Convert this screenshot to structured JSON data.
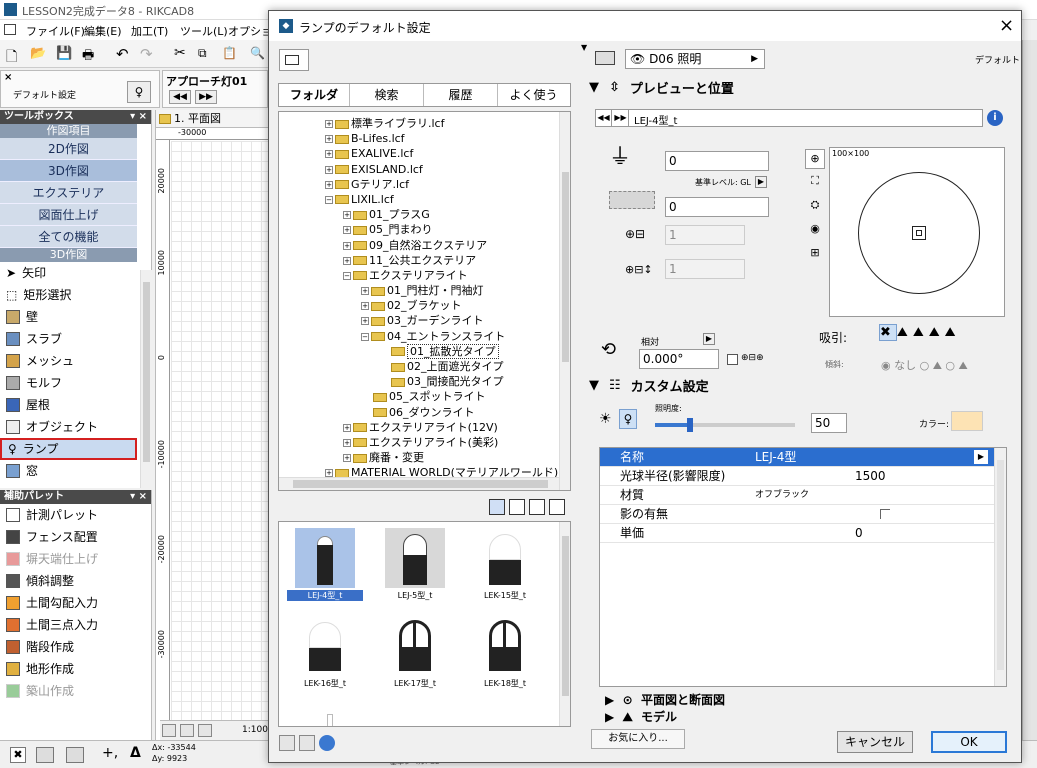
{
  "app": {
    "title": "LESSON2完成データ8 - RIKCAD8",
    "menu": [
      "ファイル(F)",
      "編集(E)",
      "加工(T)",
      "ツール(L)",
      "オプション"
    ]
  },
  "left": {
    "default_label": "デフォルト設定",
    "approach_label": "アプローチ灯01",
    "plan_tab": "1. 平面図",
    "ruler_top": "-30000",
    "ruler_v": [
      "20000",
      "10000",
      "0",
      "-10000",
      "-20000",
      "-30000"
    ],
    "toolbox_title": "ツールボックス",
    "section1": "作図項目",
    "buttons": [
      "2D作図",
      "3D作図",
      "エクステリア",
      "図面仕上げ",
      "全ての機能"
    ],
    "section2": "3D作図",
    "tools": [
      "矢印",
      "矩形選択",
      "壁",
      "スラブ",
      "メッシュ",
      "モルフ",
      "屋根",
      "オブジェクト",
      "ランプ",
      "窓"
    ],
    "palette_title": "補助パレット",
    "palette_items": [
      "計測パレット",
      "フェンス配置",
      "塀天端仕上げ",
      "傾斜調整",
      "土間勾配入力",
      "土間三点入力",
      "階段作成",
      "地形作成",
      "築山作成"
    ],
    "coord_x": "Δx: -33544",
    "coord_y": "Δy: 9923",
    "scale": "1:100",
    "status_angle": "163.62°",
    "status_layer": "基準レベル: GL"
  },
  "dialog": {
    "title": "ランプのデフォルト設定",
    "close": "×",
    "tabs": [
      "フォルダ",
      "検索",
      "履歴",
      "よく使う"
    ],
    "tree": [
      {
        "label": "標準ライブラリ.lcf",
        "depth": 0,
        "exp": "+"
      },
      {
        "label": "B-Lifes.lcf",
        "depth": 0,
        "exp": "+"
      },
      {
        "label": "EXALIVE.lcf",
        "depth": 0,
        "exp": "+"
      },
      {
        "label": "EXISLAND.lcf",
        "depth": 0,
        "exp": "+"
      },
      {
        "label": "Gテリア.lcf",
        "depth": 0,
        "exp": "+"
      },
      {
        "label": "LIXIL.lcf",
        "depth": 0,
        "exp": "-"
      },
      {
        "label": "01_プラスG",
        "depth": 1,
        "exp": "+"
      },
      {
        "label": "05_門まわり",
        "depth": 1,
        "exp": "+"
      },
      {
        "label": "09_自然浴エクステリア",
        "depth": 1,
        "exp": "+"
      },
      {
        "label": "11_公共エクステリア",
        "depth": 1,
        "exp": "+"
      },
      {
        "label": "エクステリアライト",
        "depth": 1,
        "exp": "-"
      },
      {
        "label": "01_門柱灯・門袖灯",
        "depth": 2,
        "exp": "+"
      },
      {
        "label": "02_ブラケット",
        "depth": 2,
        "exp": "+"
      },
      {
        "label": "03_ガーデンライト",
        "depth": 2,
        "exp": "+"
      },
      {
        "label": "04_エントランスライト",
        "depth": 2,
        "exp": "-"
      },
      {
        "label": "01_拡散光タイプ",
        "depth": 3,
        "exp": "",
        "sel": true
      },
      {
        "label": "02_上面遮光タイプ",
        "depth": 3,
        "exp": ""
      },
      {
        "label": "03_間接配光タイプ",
        "depth": 3,
        "exp": ""
      },
      {
        "label": "05_スポットライト",
        "depth": 2,
        "exp": ""
      },
      {
        "label": "06_ダウンライト",
        "depth": 2,
        "exp": ""
      },
      {
        "label": "エクステリアライト(12V)",
        "depth": 1,
        "exp": "+"
      },
      {
        "label": "エクステリアライト(美彩)",
        "depth": 1,
        "exp": "+"
      },
      {
        "label": "廃番・変更",
        "depth": 1,
        "exp": "+"
      },
      {
        "label": "MATERIAL WORLD(マテリアルワールド).lc",
        "depth": 0,
        "exp": "+"
      }
    ],
    "thumbs": [
      "LEJ-4型_t",
      "LEJ-5型_t",
      "LEK-15型_t",
      "LEK-16型_t",
      "LEK-17型_t",
      "LEK-18型_t"
    ],
    "layer_name": "D06 照明",
    "default_right": "デフォルト",
    "preview_header": "プレビューと位置",
    "object_name": "LEJ-4型_t",
    "height1": "0",
    "base_level": "基準レベル: GL",
    "height2": "0",
    "width_val": "1",
    "depth_val": "1",
    "preview_size": "100×100",
    "relative_label": "相対",
    "angle_value": "0.000°",
    "snap_label": "吸引:",
    "tilt_label": "傾斜:",
    "tilt_none": "なし",
    "custom_header": "カスタム設定",
    "brightness_label": "照明度:",
    "brightness_value": "50",
    "color_label": "カラー:",
    "props": [
      {
        "name": "名称",
        "value": "LEJ-4型"
      },
      {
        "name": "光球半径(影響限度)",
        "value": "1500"
      },
      {
        "name": "材質",
        "value": "オフブラック"
      },
      {
        "name": "影の有無",
        "value": ""
      },
      {
        "name": "単価",
        "value": "0"
      }
    ],
    "section_plan": "平面図と断面図",
    "section_model": "モデル",
    "favorites_button": "お気に入り...",
    "cancel_button": "キャンセル",
    "ok_button": "OK"
  }
}
